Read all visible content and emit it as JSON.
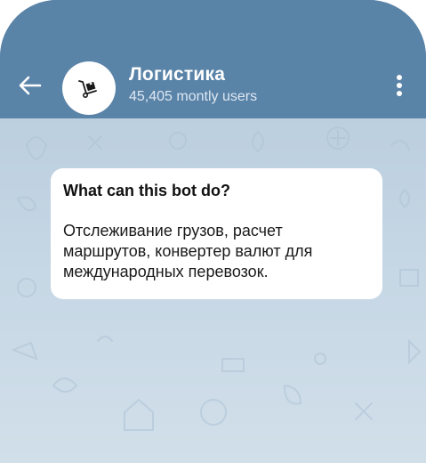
{
  "header": {
    "title": "Логистика",
    "subtitle": "45,405 montly users",
    "bg_color": "#5a83a8"
  },
  "icons": {
    "back": "arrow-left-icon",
    "avatar": "hand-truck-box-icon",
    "menu": "vertical-dots-icon"
  },
  "bot_info": {
    "heading": "What can this bot do?",
    "description": "Отслеживание грузов, расчет маршрутов, конвертер валют для международных перевозок."
  }
}
